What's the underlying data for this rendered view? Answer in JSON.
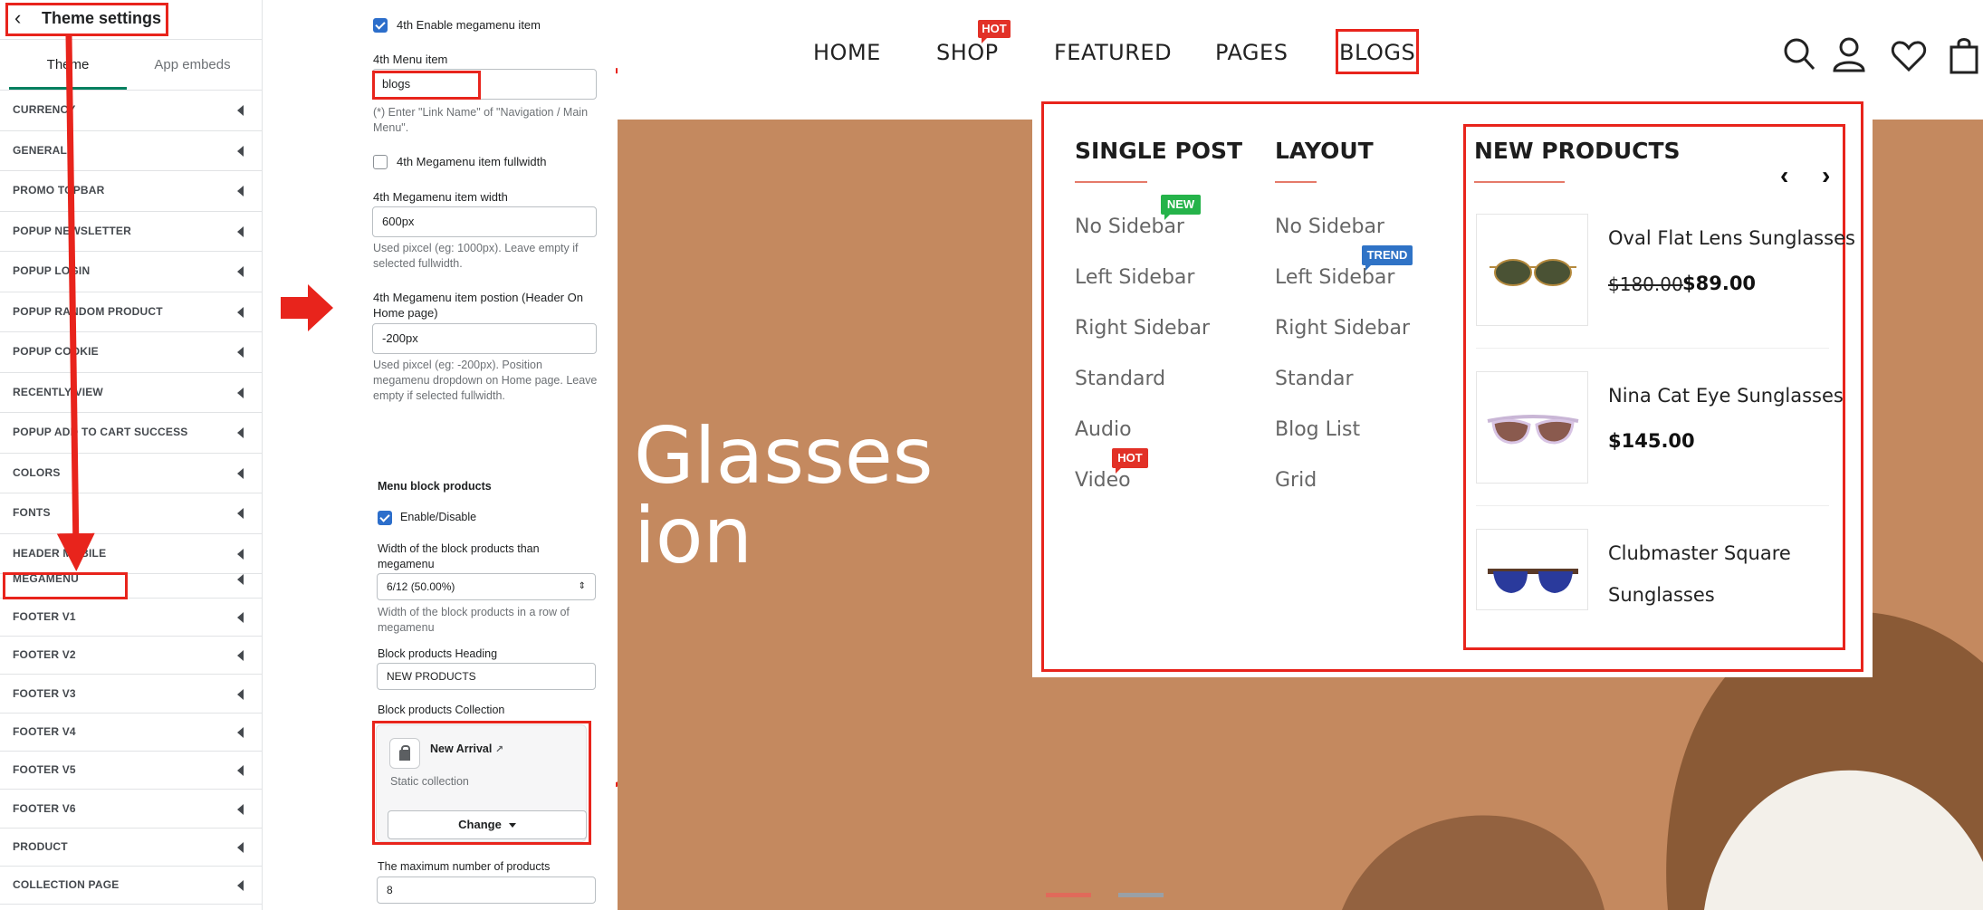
{
  "panel": {
    "back_icon": "chevron-left-icon",
    "title": "Theme settings",
    "tabs": [
      "Theme",
      "App embeds"
    ],
    "sections": [
      "CURRENCY",
      "GENERAL",
      "PROMO TOPBAR",
      "POPUP NEWSLETTER",
      "POPUP LOGIN",
      "POPUP RANDOM PRODUCT",
      "POPUP COOKIE",
      "RECENTLY VIEW",
      "POPUP ADD TO CART SUCCESS",
      "COLORS",
      "FONTS",
      "HEADER MOBILE",
      "MEGAMENU",
      "FOOTER V1",
      "FOOTER V2",
      "FOOTER V3",
      "FOOTER V4",
      "FOOTER V5",
      "FOOTER V6",
      "PRODUCT",
      "COLLECTION PAGE"
    ]
  },
  "settings": {
    "enable_item_label": "4th Enable megamenu item",
    "menu_item_label": "4th Menu item",
    "menu_item_value": "blogs",
    "menu_item_help": "(*) Enter \"Link Name\" of \"Navigation / Main Menu\".",
    "fullwidth_label": "4th Megamenu item fullwidth",
    "width_label": "4th Megamenu item width",
    "width_value": "600px",
    "width_help": "Used pixcel (eg: 1000px). Leave empty if selected fullwidth.",
    "position_label": "4th Megamenu item postion (Header On Home page)",
    "position_value": "-200px",
    "position_help": "Used pixcel (eg: -200px). Position megamenu dropdown on Home page. Leave empty if selected fullwidth.",
    "block_title": "Menu block products",
    "enable_disable_label": "Enable/Disable",
    "block_width_label": "Width of the block products than megamenu",
    "block_width_value": "6/12 (50.00%)",
    "block_width_help": "Width of the block products in a row of megamenu",
    "heading_label": "Block products Heading",
    "heading_value": "NEW PRODUCTS",
    "collection_label": "Block products Collection",
    "collection_name": "New Arrival",
    "collection_type": "Static collection",
    "change_label": "Change",
    "max_label": "The maximum number of products",
    "max_value": "8"
  },
  "store": {
    "nav": [
      "HOME",
      "SHOP",
      "FEATURED",
      "PAGES",
      "BLOGS"
    ],
    "shop_badge": "HOT",
    "icons": [
      "search-icon",
      "account-icon",
      "heart-icon",
      "bag-icon"
    ],
    "hero_line1": "Glasses",
    "hero_line2": "ion",
    "mega": {
      "col1_title": "SINGLE POST",
      "col1_items": [
        "No Sidebar",
        "Left Sidebar",
        "Right Sidebar",
        "Standard",
        "Audio",
        "Video"
      ],
      "col1_badge_new": "NEW",
      "col1_badge_hot": "HOT",
      "col2_title": "LAYOUT",
      "col2_items": [
        "No Sidebar",
        "Left Sidebar",
        "Right Sidebar",
        "Standar",
        "Blog List",
        "Grid"
      ],
      "col2_badge_trend": "TREND",
      "products_title": "NEW PRODUCTS",
      "prev": "‹",
      "next": "›",
      "products": [
        {
          "name": "Oval Flat Lens Sunglasses",
          "old_price": "$180.00",
          "price": "$89.00"
        },
        {
          "name": "Nina Cat Eye Sunglasses",
          "price": "$145.00"
        },
        {
          "name_line1": "Clubmaster Square",
          "name_line2": "Sunglasses"
        }
      ]
    }
  },
  "colors": {
    "annotation_red": "#e8241c",
    "hero_bg": "#c4895f",
    "checkbox_blue": "#2c6ecb",
    "tab_green": "#008060"
  }
}
